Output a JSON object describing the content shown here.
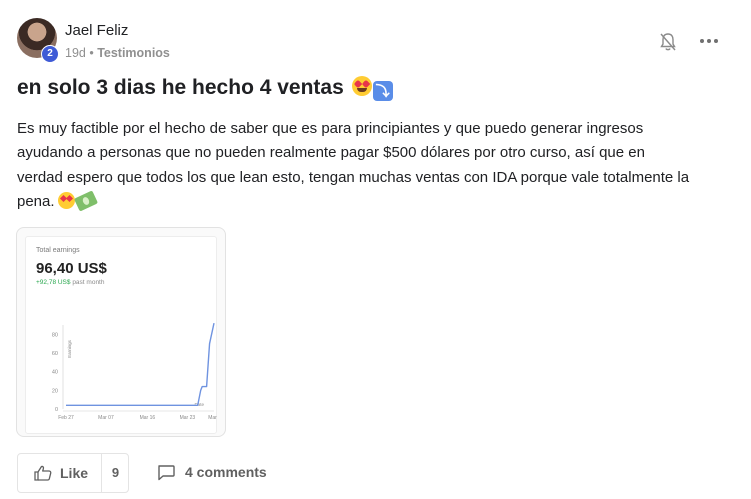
{
  "post": {
    "author": {
      "name": "Jael Feliz",
      "level": "2"
    },
    "meta": {
      "age": "19d",
      "separator": " • ",
      "category": "Testimonios"
    },
    "title": "en solo 3 dias he hecho 4 ventas",
    "body_lines": [
      "Es muy factible por el hecho de saber que es para principiantes y que puedo generar ingresos",
      "ayudando a personas que no pueden realmente pagar $500 dólares por otro curso, así que en",
      "verdad espero que todos los que lean esto, tengan muchas ventas con IDA porque vale totalmente la",
      "pena."
    ],
    "icons": {
      "notify": "bell-off-icon",
      "more": "more-horizontal-icon",
      "like": "thumbs-up-icon",
      "comment": "comment-icon"
    },
    "attachment": {
      "label": "Total earnings",
      "value": "96,40 US$",
      "delta": "+92,78 US$",
      "delta_suffix": " past month",
      "chart_data": {
        "type": "line",
        "ylabel": "Earnings",
        "ylim": [
          0,
          90
        ],
        "yticks": [
          "0",
          "20",
          "40",
          "60",
          "80"
        ],
        "xticks": [
          "Feb 27",
          "Mar 07",
          "Mar 16",
          "Mar 23",
          "Mar"
        ],
        "annotation": "Date",
        "series": [
          {
            "x": [
              0,
              0.88,
              0.89,
              0.91,
              0.92,
              0.95,
              0.97,
              1.0
            ],
            "y": [
              4,
              4,
              4,
              20,
              24,
              24,
              70,
              92
            ]
          }
        ],
        "colors": {
          "line": "#6f93e0",
          "axis": "#cfcfcf",
          "text": "#8a8a8a"
        }
      }
    },
    "actions": {
      "like_label": "Like",
      "like_count": "9",
      "comments_label": "4 comments"
    }
  }
}
